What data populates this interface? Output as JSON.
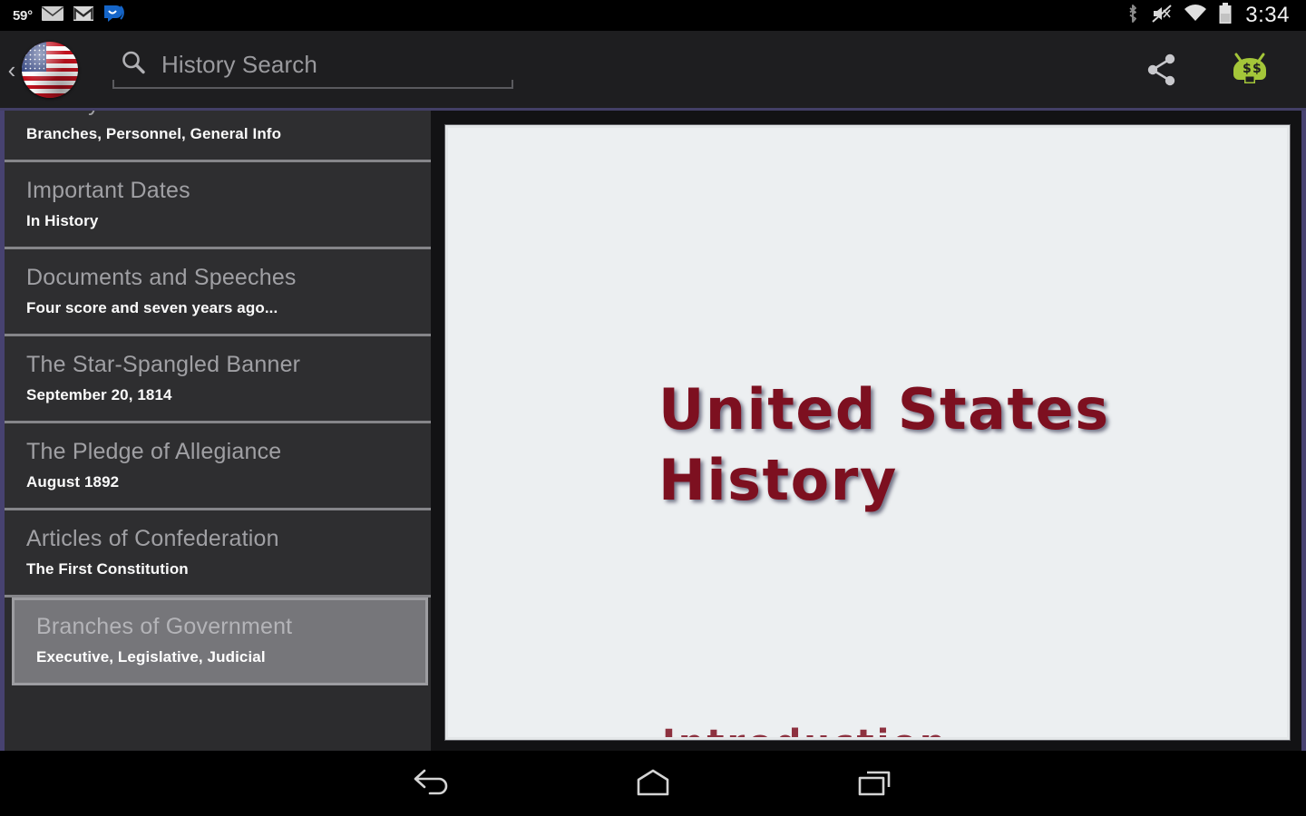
{
  "status_bar": {
    "temperature": "59°",
    "clock": "3:34",
    "left_icons": [
      {
        "name": "email-icon"
      },
      {
        "name": "gmail-icon"
      },
      {
        "name": "airdroid-icon"
      }
    ],
    "right_icons": [
      {
        "name": "bluetooth-icon"
      },
      {
        "name": "volume-muted-icon"
      },
      {
        "name": "wifi-icon"
      },
      {
        "name": "battery-icon"
      }
    ]
  },
  "action_bar": {
    "up_caret": "‹",
    "app_icon": "us-flag-icon",
    "search": {
      "placeholder": "History Search",
      "value": "",
      "icon": "search-icon"
    },
    "actions": [
      {
        "name": "share-icon",
        "label": "Share"
      },
      {
        "name": "android-money-icon",
        "label": "Ads"
      }
    ]
  },
  "sidebar": {
    "items": [
      {
        "title": "Military",
        "subtitle": "Branches, Personnel, General Info",
        "selected": false,
        "clipped": true
      },
      {
        "title": "Important Dates",
        "subtitle": "In History",
        "selected": false,
        "clipped": false
      },
      {
        "title": "Documents and Speeches",
        "subtitle": "Four score and seven years ago...",
        "selected": false,
        "clipped": false
      },
      {
        "title": "The Star-Spangled Banner",
        "subtitle": "September 20, 1814",
        "selected": false,
        "clipped": false
      },
      {
        "title": "The Pledge of Allegiance",
        "subtitle": "August 1892",
        "selected": false,
        "clipped": false
      },
      {
        "title": "Articles of Confederation",
        "subtitle": "The First Constitution",
        "selected": false,
        "clipped": false
      },
      {
        "title": "Branches of Government",
        "subtitle": "Executive, Legislative, Judicial",
        "selected": true,
        "clipped": false
      }
    ]
  },
  "main": {
    "title_line_1": "United States",
    "title_line_2": "History",
    "clipped_bottom_text": "Introduction"
  },
  "nav_bar": {
    "buttons": [
      {
        "name": "back-button",
        "label": "Back"
      },
      {
        "name": "home-button",
        "label": "Home"
      },
      {
        "name": "recents-button",
        "label": "Recent apps"
      }
    ]
  },
  "colors": {
    "accent_purple": "#474270",
    "title_maroon": "#7d1020",
    "action_bar_bg": "#1e1e20",
    "sidebar_row_bg": "#2e2e30",
    "selected_row_bg": "#76767a",
    "card_bg": "#eceff1",
    "android_green": "#a4c639"
  }
}
